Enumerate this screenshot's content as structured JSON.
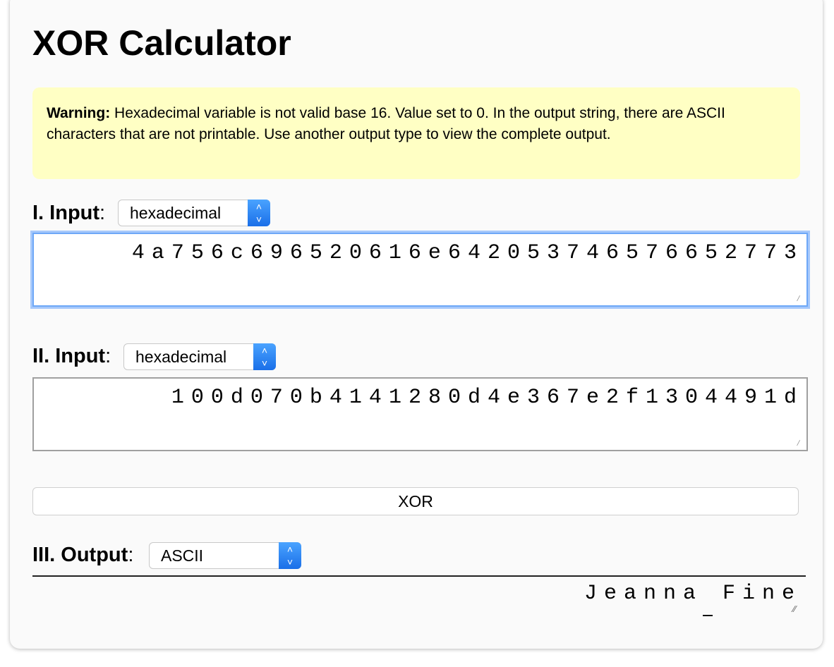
{
  "app": {
    "title": "XOR Calculator"
  },
  "warning": {
    "label": "Warning:",
    "text": " Hexadecimal variable is not valid base 16. Value set to 0. In the output string, there are ASCII characters that are not printable. Use another output type to view the complete output."
  },
  "input1": {
    "label": "I. Input",
    "colon": ":",
    "type_selected": "hexadecimal",
    "value": "4a756c696520616e64205374657665277 3"
  },
  "input2": {
    "label": "II. Input",
    "colon": ":",
    "type_selected": "hexadecimal",
    "value": "100d070b4141280d4e367e2f1304491d"
  },
  "button": {
    "xor_label": "XOR"
  },
  "output": {
    "label": "III. Output",
    "colon": ":",
    "type_selected": "ASCII",
    "value": "Jeanna Fine"
  },
  "icons": {
    "select_arrow": "chevron-up-down-icon",
    "resize_handle": "resize-grip-icon"
  },
  "colors": {
    "warning_bg": "#ffffc4",
    "select_accent": "#2f86f5",
    "focus_ring": "#6ea8f7"
  }
}
